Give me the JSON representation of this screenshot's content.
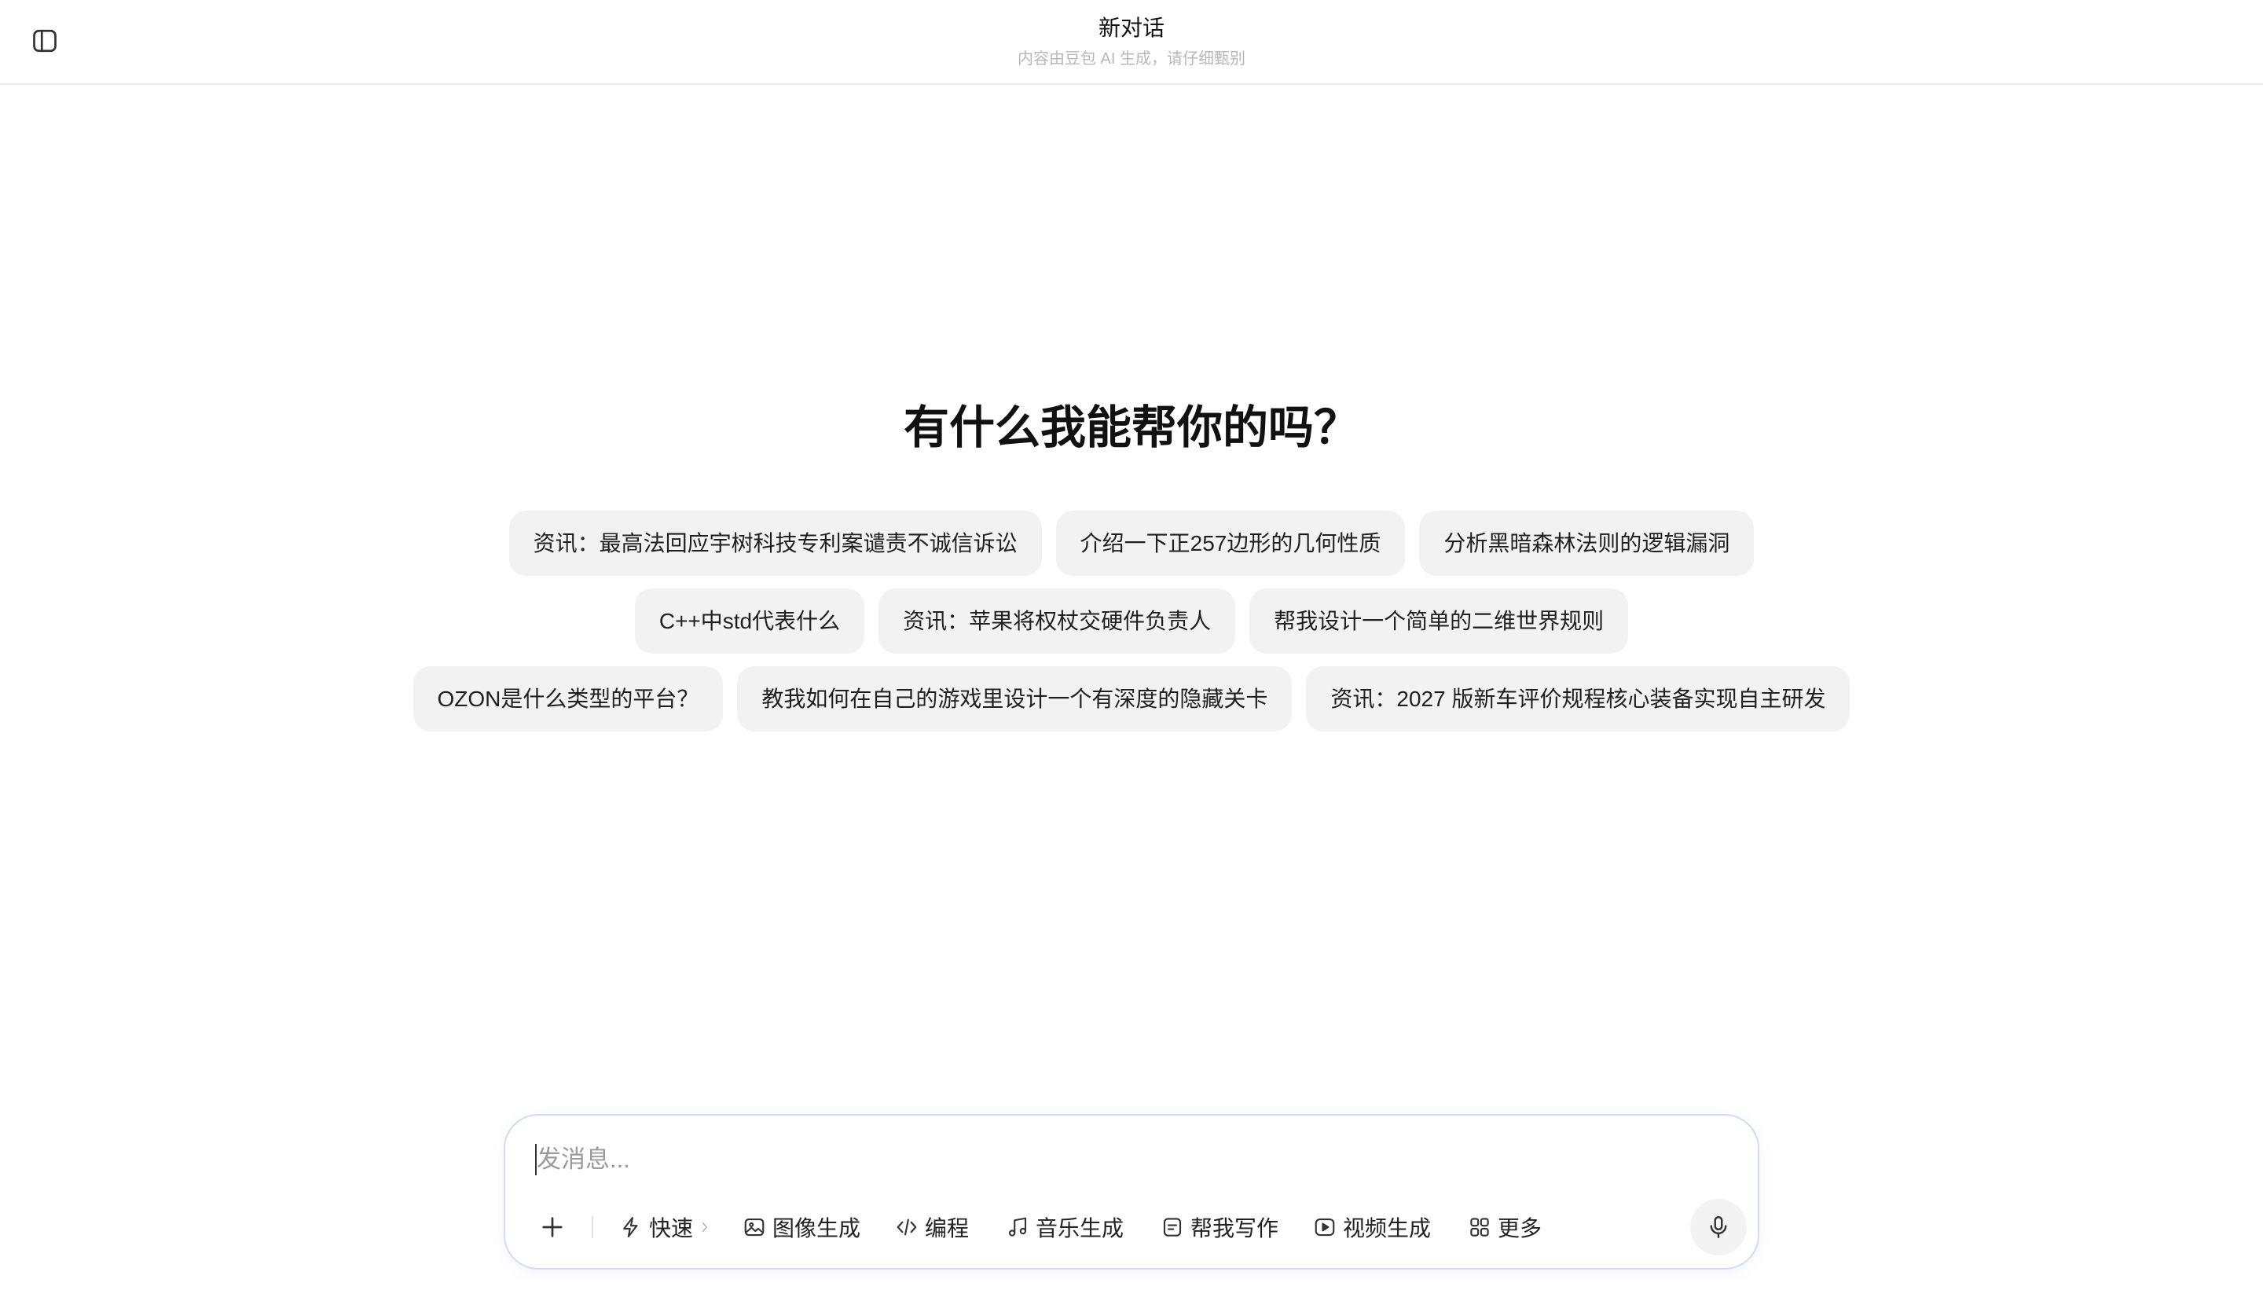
{
  "colors": {
    "chip_bg": "#f2f2f2",
    "input_border": "#cddcf7",
    "mic_bg": "#f3f3f3",
    "muted_text": "#b8b8b8"
  },
  "header": {
    "sidebar_toggle_icon": "sidebar-toggle-icon",
    "title": "新对话",
    "subtitle": "内容由豆包 AI 生成，请仔细甄别"
  },
  "main": {
    "heading": "有什么我能帮你的吗？",
    "suggestions": [
      [
        "资讯：最高法回应宇树科技专利案谴责不诚信诉讼",
        "介绍一下正257边形的几何性质",
        "分析黑暗森林法则的逻辑漏洞"
      ],
      [
        "C++中std代表什么",
        "资讯：苹果将权杖交硬件负责人",
        "帮我设计一个简单的二维世界规则"
      ],
      [
        "OZON是什么类型的平台？",
        "教我如何在自己的游戏里设计一个有深度的隐藏关卡",
        "资讯：2027 版新车评价规程核心装备实现自主研发"
      ]
    ]
  },
  "composer": {
    "placeholder": "发消息...",
    "attach_icon": "plus-icon",
    "tools": {
      "fast": {
        "label": "快速",
        "icon": "lightning-icon"
      },
      "image": {
        "label": "图像生成",
        "icon": "image-icon"
      },
      "code": {
        "label": "编程",
        "icon": "code-icon"
      },
      "music": {
        "label": "音乐生成",
        "icon": "music-note-icon"
      },
      "write": {
        "label": "帮我写作",
        "icon": "document-icon"
      },
      "video": {
        "label": "视频生成",
        "icon": "play-icon"
      },
      "more": {
        "label": "更多",
        "icon": "grid-icon"
      }
    },
    "mic_icon": "microphone-icon"
  }
}
